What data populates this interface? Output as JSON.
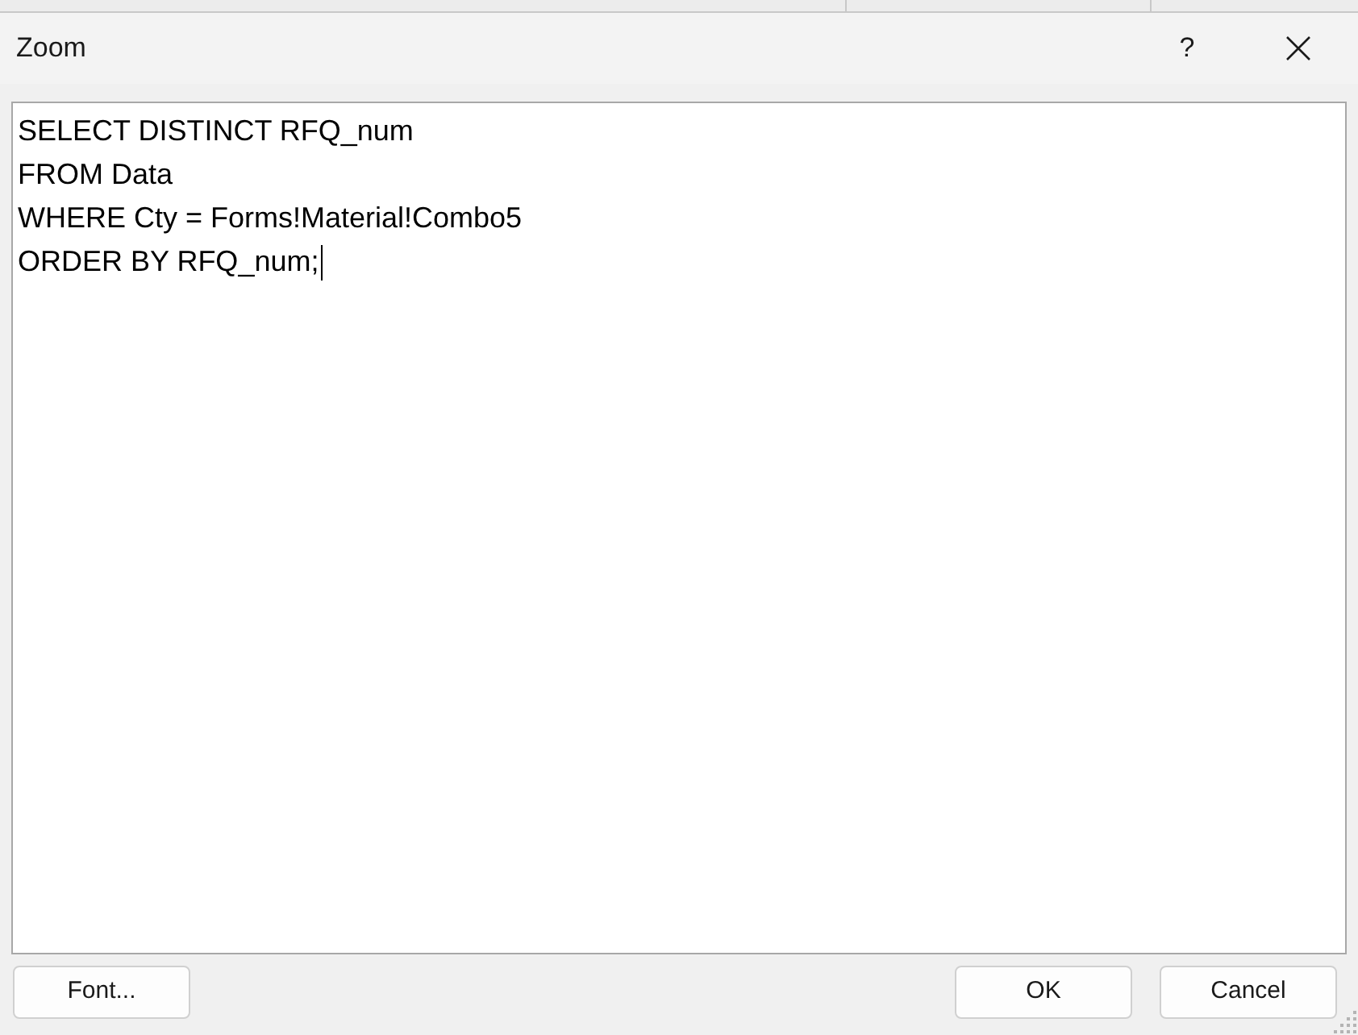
{
  "window": {
    "title": "Zoom",
    "help_button": "?"
  },
  "editor": {
    "lines": [
      "SELECT DISTINCT RFQ_num",
      "FROM Data",
      "WHERE Cty = Forms!Material!Combo5",
      "ORDER BY RFQ_num;"
    ],
    "focused": true
  },
  "buttons": [
    {
      "label": "Font...",
      "kind": "left"
    },
    {
      "label": "OK",
      "kind": "right"
    },
    {
      "label": "Cancel",
      "kind": "right"
    }
  ]
}
